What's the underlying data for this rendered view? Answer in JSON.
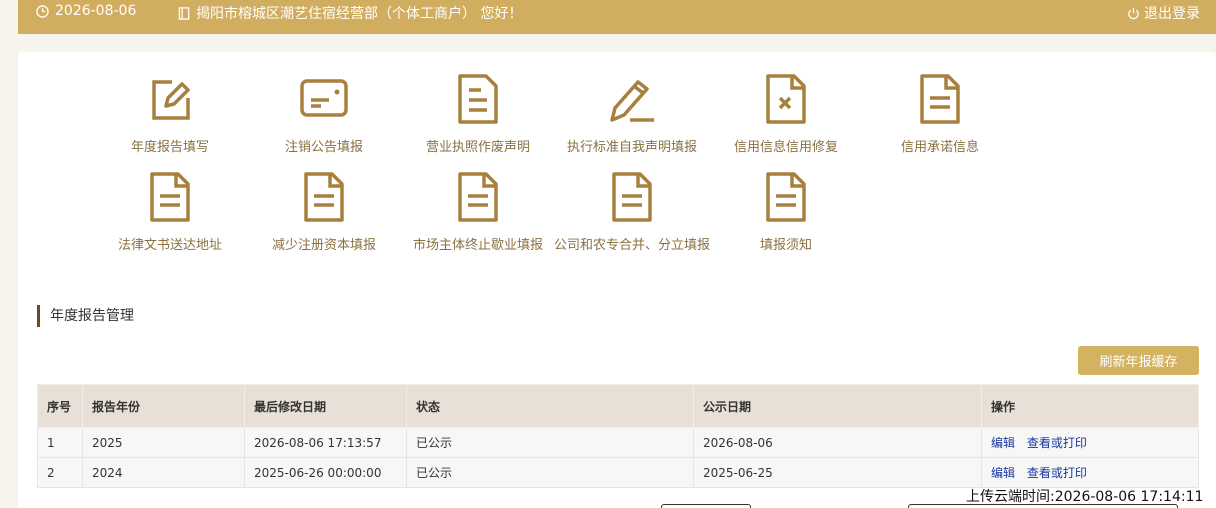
{
  "header": {
    "date": "2026-08-06",
    "greeting": "揭阳市榕城区潮艺住宿经营部（个体工商户） 您好！",
    "logout": "退出登录"
  },
  "tiles": [
    {
      "label": "年度报告填写",
      "icon": "edit-icon"
    },
    {
      "label": "注销公告填报",
      "icon": "card-icon"
    },
    {
      "label": "营业执照作废声明",
      "icon": "document-icon"
    },
    {
      "label": "执行标准自我声明填报",
      "icon": "pencil-icon"
    },
    {
      "label": "信用信息信用修复",
      "icon": "document-x-icon"
    },
    {
      "label": "信用承诺信息",
      "icon": "document-icon"
    },
    {
      "label": "法律文书送达地址",
      "icon": "document-icon"
    },
    {
      "label": "减少注册资本填报",
      "icon": "document-icon"
    },
    {
      "label": "市场主体终止歇业填报",
      "icon": "document-icon"
    },
    {
      "label": "公司和农专合并、分立填报",
      "icon": "document-icon"
    },
    {
      "label": "填报须知",
      "icon": "document-icon"
    }
  ],
  "section": {
    "title": "年度报告管理"
  },
  "refresh_button": "刷新年报缓存",
  "table": {
    "headers": [
      "序号",
      "报告年份",
      "最后修改日期",
      "状态",
      "公示日期",
      "操作"
    ],
    "rows": [
      {
        "no": "1",
        "year": "2025",
        "modified": "2026-08-06 17:13:57",
        "status": "已公示",
        "publish": "2026-08-06",
        "edit": "编辑",
        "view": "查看或打印"
      },
      {
        "no": "2",
        "year": "2024",
        "modified": "2025-06-26 00:00:00",
        "status": "已公示",
        "publish": "2025-06-25",
        "edit": "编辑",
        "view": "查看或打印"
      }
    ]
  },
  "upload_time": "上传云端时间:2026-08-06 17:14:11",
  "colors": {
    "accent": "#d1ad5f",
    "icon": "#a8803e",
    "label": "#8a7040",
    "link": "#1a36a0"
  }
}
